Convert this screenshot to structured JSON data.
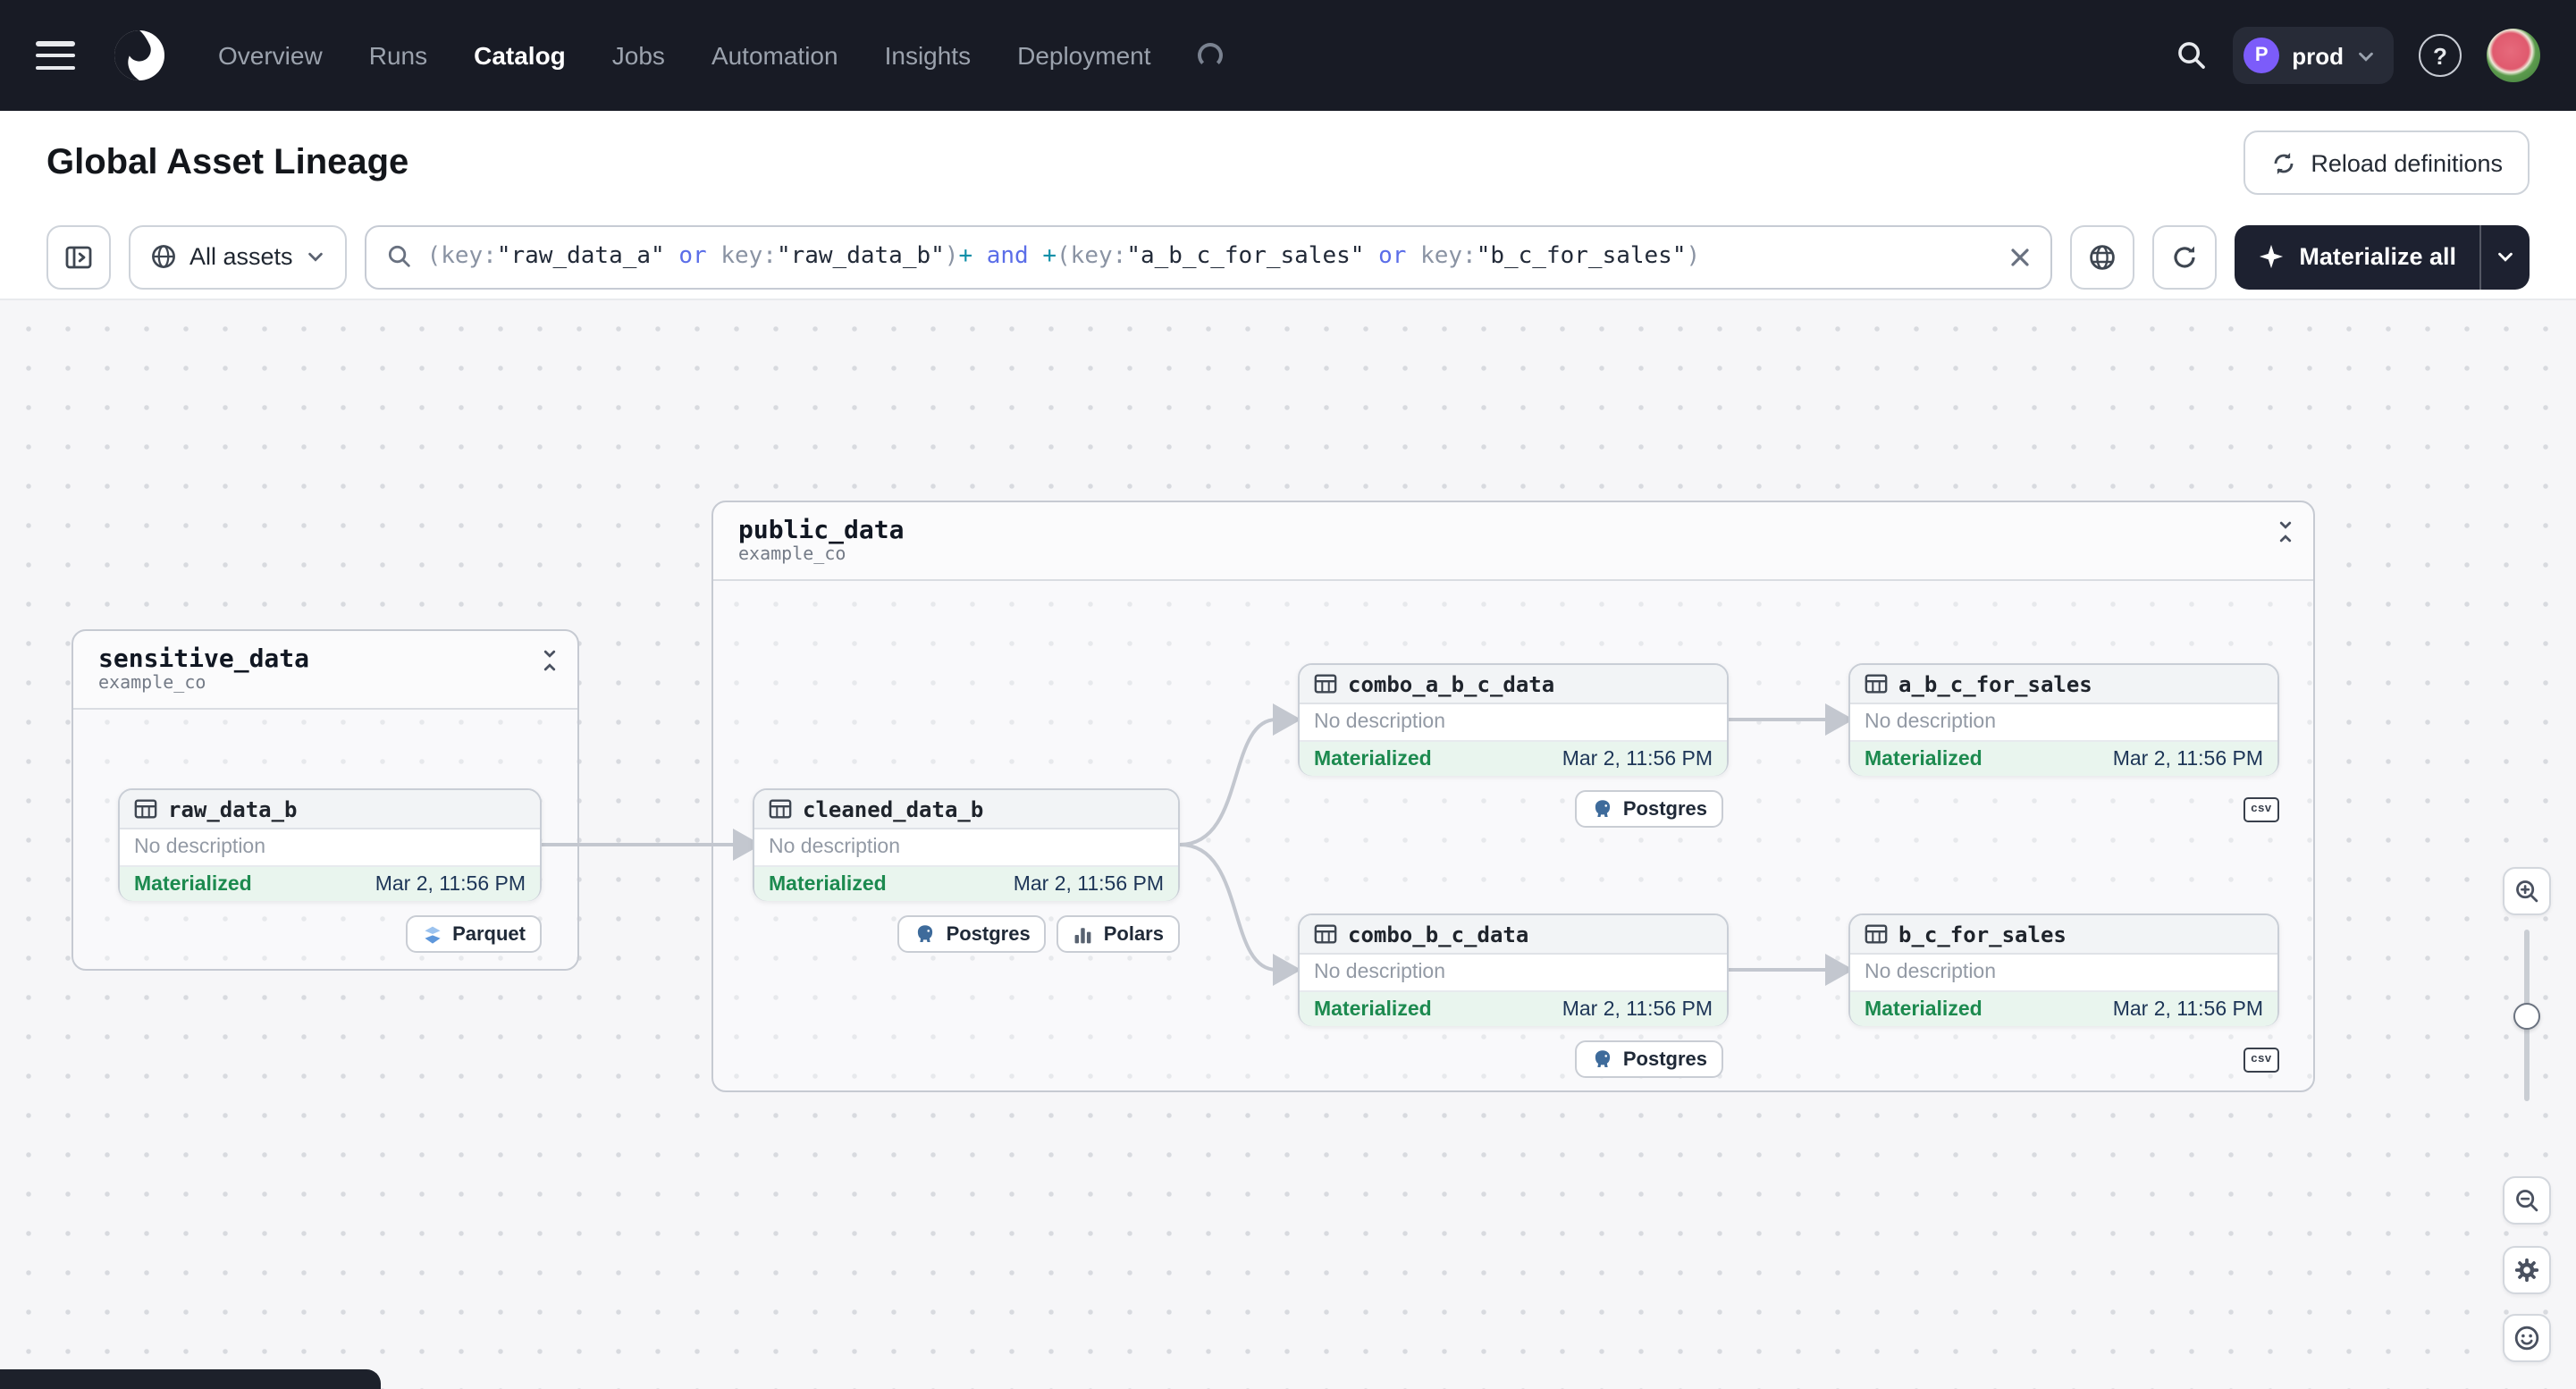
{
  "nav": {
    "items": [
      "Overview",
      "Runs",
      "Catalog",
      "Jobs",
      "Automation",
      "Insights",
      "Deployment"
    ],
    "env": {
      "initial": "P",
      "name": "prod"
    }
  },
  "header": {
    "title": "Global Asset Lineage",
    "reload_label": "Reload definitions"
  },
  "toolbar": {
    "scope_label": "All assets",
    "materialize_label": "Materialize all",
    "query": {
      "segments": [
        {
          "text": "(key:"
        },
        {
          "text": "\"raw_data_a\""
        },
        {
          "text": " or "
        },
        {
          "text": "key:"
        },
        {
          "text": "\"raw_data_b\""
        },
        {
          "text": ")"
        },
        {
          "text": "+"
        },
        {
          "text": " and "
        },
        {
          "text": "+"
        },
        {
          "text": "(key:"
        },
        {
          "text": "\"a_b_c_for_sales\""
        },
        {
          "text": " or "
        },
        {
          "text": "key:"
        },
        {
          "text": "\"b_c_for_sales\""
        },
        {
          "text": ")"
        }
      ]
    }
  },
  "graph": {
    "groups": [
      {
        "name": "sensitive_data",
        "subtitle": "example_co"
      },
      {
        "name": "public_data",
        "subtitle": "example_co"
      }
    ],
    "nodes": [
      {
        "name": "raw_data_b",
        "description": "No description",
        "status": "Materialized",
        "timestamp": "Mar 2, 11:56 PM"
      },
      {
        "name": "cleaned_data_b",
        "description": "No description",
        "status": "Materialized",
        "timestamp": "Mar 2, 11:56 PM"
      },
      {
        "name": "combo_a_b_c_data",
        "description": "No description",
        "status": "Materialized",
        "timestamp": "Mar 2, 11:56 PM"
      },
      {
        "name": "a_b_c_for_sales",
        "description": "No description",
        "status": "Materialized",
        "timestamp": "Mar 2, 11:56 PM"
      },
      {
        "name": "combo_b_c_data",
        "description": "No description",
        "status": "Materialized",
        "timestamp": "Mar 2, 11:56 PM"
      },
      {
        "name": "b_c_for_sales",
        "description": "No description",
        "status": "Materialized",
        "timestamp": "Mar 2, 11:56 PM"
      }
    ],
    "tags": {
      "parquet": "Parquet",
      "postgres": "Postgres",
      "polars": "Polars",
      "csv": "csv"
    }
  }
}
